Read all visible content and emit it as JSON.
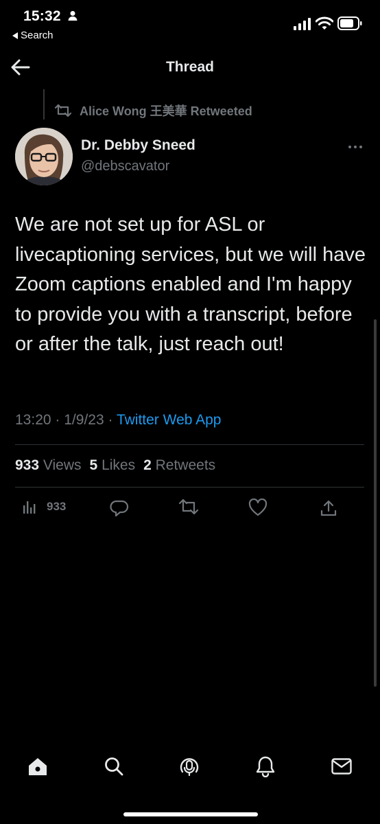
{
  "status_bar": {
    "time": "15:32",
    "back_label": "Search"
  },
  "header": {
    "title": "Thread"
  },
  "tweet": {
    "retweeted_by": "Alice Wong 王美華 Retweeted",
    "author_name": "Dr. Debby Sneed",
    "author_handle": "@debscavator",
    "text": "We are not set up for ASL or livecaptioning services, but we will have Zoom captions enabled and I'm happy to provide you with a transcript, before or after the talk, just reach out!",
    "time": "13:20",
    "date": "1/9/23",
    "separator": "·",
    "source": "Twitter Web App",
    "stats": {
      "views_count": "933",
      "views_label": "Views",
      "likes_count": "5",
      "likes_label": "Likes",
      "retweets_count": "2",
      "retweets_label": "Retweets"
    },
    "actions": {
      "analytics_count": "933"
    }
  },
  "icons": {
    "back": "arrow-left-icon",
    "retweet": "retweet-icon",
    "more": "more-dots-icon",
    "analytics": "bar-chart-icon",
    "reply": "reply-icon",
    "like": "heart-icon",
    "share": "share-icon"
  },
  "bottom_tabs": [
    "home-icon",
    "search-icon",
    "spaces-icon",
    "notifications-icon",
    "messages-icon"
  ],
  "colors": {
    "background": "#000000",
    "primary_text": "#e7e9ea",
    "secondary_text": "#71767b",
    "link": "#1d9bf0",
    "divider": "#2f3336"
  }
}
